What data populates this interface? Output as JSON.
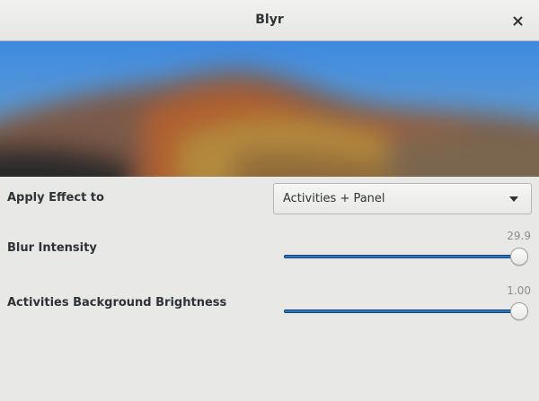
{
  "window": {
    "title": "Blyr",
    "close_icon": "close-icon"
  },
  "preview": {
    "description_icon": "blurred-landscape-preview"
  },
  "settings": {
    "apply_effect": {
      "label": "Apply Effect to",
      "selected": "Activities + Panel",
      "dropdown_icon": "chevron-down-icon"
    },
    "blur_intensity": {
      "label": "Blur Intensity",
      "value": "29.9",
      "fraction": 1.0
    },
    "brightness": {
      "label": "Activities Background Brightness",
      "value": "1.00",
      "fraction": 1.0
    }
  },
  "colors": {
    "accent": "#2a76c6",
    "background": "#e8e8e7"
  }
}
